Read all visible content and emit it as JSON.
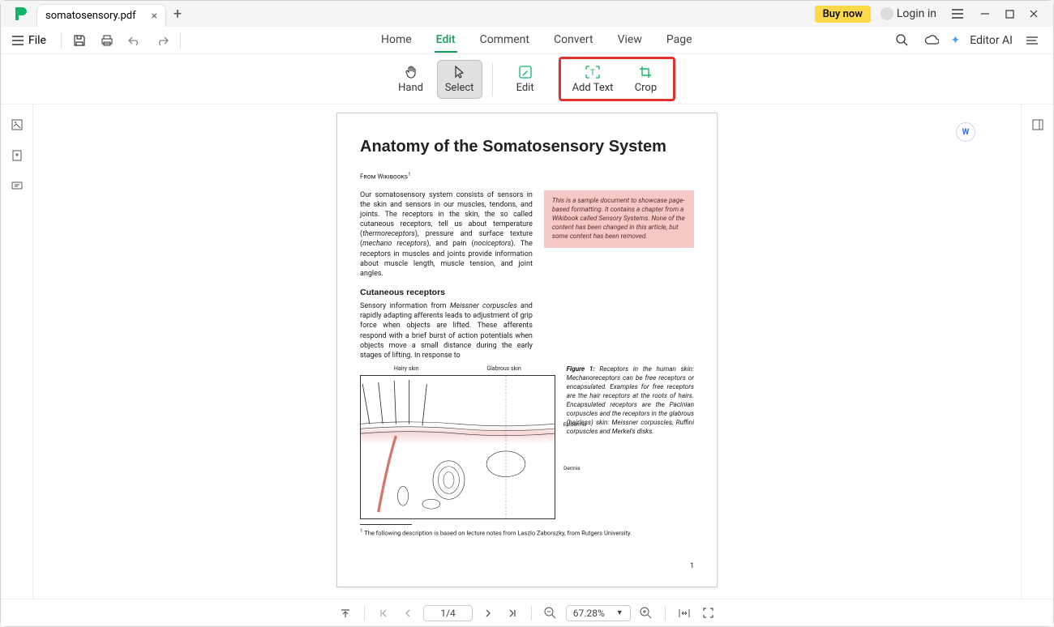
{
  "titlebar": {
    "tab_name": "somatosensory.pdf",
    "buy_now": "Buy now",
    "login": "Login in"
  },
  "quickbar": {
    "file": "File"
  },
  "menu": {
    "home": "Home",
    "edit": "Edit",
    "comment": "Comment",
    "convert": "Convert",
    "view": "View",
    "page": "Page",
    "editor_ai": "Editor AI"
  },
  "tools": {
    "hand": "Hand",
    "select": "Select",
    "edit": "Edit",
    "add_text": "Add Text",
    "crop": "Crop"
  },
  "bottombar": {
    "page_indicator": "1/4",
    "zoom": "67.28%"
  },
  "document": {
    "title": "Anatomy of the Somatosensory System",
    "source": "From Wikibooks",
    "source_sup": "1",
    "para1a": "Our somatosensory system consists of sensors in the skin and sensors in our muscles, tendons, and joints. The receptors in the skin, the so called cutaneous receptors, tell us about temperature (",
    "para1b": "thermoreceptors",
    "para1c": "), pressure and surface texture (",
    "para1d": "mechano receptors",
    "para1e": "), and pain (",
    "para1f": "nociceptors",
    "para1g": "). The receptors in muscles and joints provide information about muscle length, muscle tension, and joint angles.",
    "callout": "This is a sample document to showcase page-based formatting. It contains a chapter from a Wikibook called Sensory Systems. None of the content has been changed in this article, but some content has been removed.",
    "h3": "Cutaneous receptors",
    "para2a": "Sensory information from ",
    "para2b": "Meissner corpuscles",
    "para2c": " and rapidly adapting afferents leads to adjustment of grip force when objects are lifted. These afferents respond with a brief burst of action potentials when objects move a small distance during the early stages of lifting. In response to",
    "fig_label": "Figure 1:",
    "fig_caption": " Receptors in the human skin: Mechanoreceptors can be free receptors or encapsulated. Examples for free receptors are the hair receptors at the roots of hairs. Encapsulated receptors are the Pacinian corpuscles and the receptors in the glabrous (hairless) skin: Meissner corpuscles, Ruffini corpuscles and Merkel's disks.",
    "fig_labels": {
      "hairy": "Hairy skin",
      "glabrous": "Glabrous skin",
      "epidermis": "Epidermis",
      "dermis": "Dermis"
    },
    "footnote_sup": "1",
    "footnote": " The following description is based on lecture notes from Laszlo Zaborszky, from Rutgers University.",
    "page_number": "1"
  }
}
